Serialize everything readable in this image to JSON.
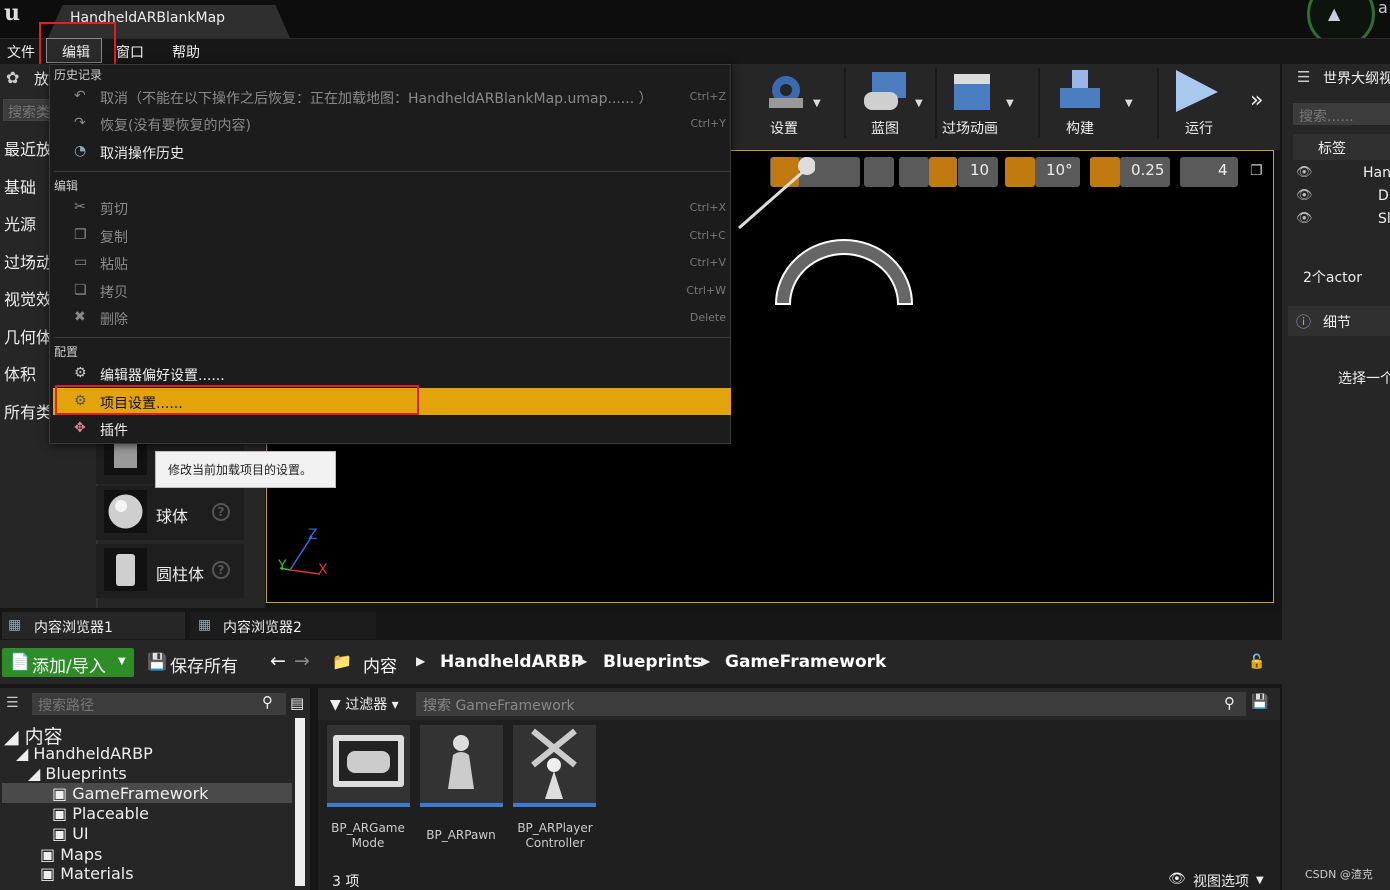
{
  "window": {
    "doc_tab": "HandheldARBlankMap",
    "corner_letter": "a"
  },
  "menubar": {
    "file": "文件",
    "edit": "编辑",
    "window": "窗口",
    "help": "帮助"
  },
  "left_panel": {
    "header": "放",
    "search_placeholder": "搜索类",
    "categories": [
      "最近放",
      "基础",
      "光源",
      "过场动",
      "视觉效",
      "几何体",
      "体积",
      "所有类"
    ],
    "shapes": [
      {
        "label": ""
      },
      {
        "label": "球体"
      },
      {
        "label": "圆柱体"
      }
    ]
  },
  "edit_menu": {
    "history_section": "历史记录",
    "undo": "取消（不能在以下操作之后恢复：正在加载地图：HandheldARBlankMap.umap...... ）",
    "undo_shortcut": "Ctrl+Z",
    "redo": "恢复(没有要恢复的内容)",
    "redo_shortcut": "Ctrl+Y",
    "undo_history": "取消操作历史",
    "edit_section": "编辑",
    "cut": "剪切",
    "cut_shortcut": "Ctrl+X",
    "copy": "复制",
    "copy_shortcut": "Ctrl+C",
    "paste": "粘贴",
    "paste_shortcut": "Ctrl+V",
    "duplicate": "拷贝",
    "duplicate_shortcut": "Ctrl+W",
    "delete": "删除",
    "delete_shortcut": "Delete",
    "config_section": "配置",
    "editor_prefs": "编辑器偏好设置......",
    "project_settings": "项目设置......",
    "plugins": "插件",
    "tooltip": "修改当前加载项目的设置。"
  },
  "toolbar": {
    "settings": "设置",
    "blueprints": "蓝图",
    "cinematics": "过场动画",
    "build": "构建",
    "play": "运行"
  },
  "viewport": {
    "grid_snap": "10",
    "rotation_snap": "10°",
    "scale_snap": "0.25",
    "camera_speed": "4",
    "axis_x": "X",
    "axis_y": "Y",
    "axis_z": "Z"
  },
  "outliner": {
    "title": "世界大纲视",
    "search_placeholder": "搜索......",
    "tag_header": "标签",
    "rows": [
      "Han",
      "Di",
      "Sl"
    ],
    "actor_count": "2个actor",
    "details_title": "细节",
    "details_hint": "选择一个"
  },
  "content_browser": {
    "tab1": "内容浏览器1",
    "tab2": "内容浏览器2",
    "add_import": "添加/导入",
    "save_all": "保存所有",
    "breadcrumb": [
      "内容",
      "HandheldARBP",
      "Blueprints",
      "GameFramework"
    ],
    "path_search_placeholder": "搜索路径",
    "filters": "过滤器",
    "asset_search_placeholder": "搜索 GameFramework",
    "folders": [
      "内容",
      "HandheldARBP",
      "Blueprints",
      "GameFramework",
      "Placeable",
      "UI",
      "Maps",
      "Materials"
    ],
    "assets": [
      {
        "line1": "BP_ARGame",
        "line2": "Mode"
      },
      {
        "line1": "BP_ARPawn",
        "line2": ""
      },
      {
        "line1": "BP_ARPlayer",
        "line2": "Controller"
      }
    ],
    "item_count": "3 项",
    "view_options": "视图选项"
  },
  "watermark": "CSDN @渣克",
  "colors": {
    "highlight": "#e2a40a",
    "annotation_red": "#e02020",
    "add_button": "#2d8d26",
    "asset_underline": "#3a7bd5"
  }
}
